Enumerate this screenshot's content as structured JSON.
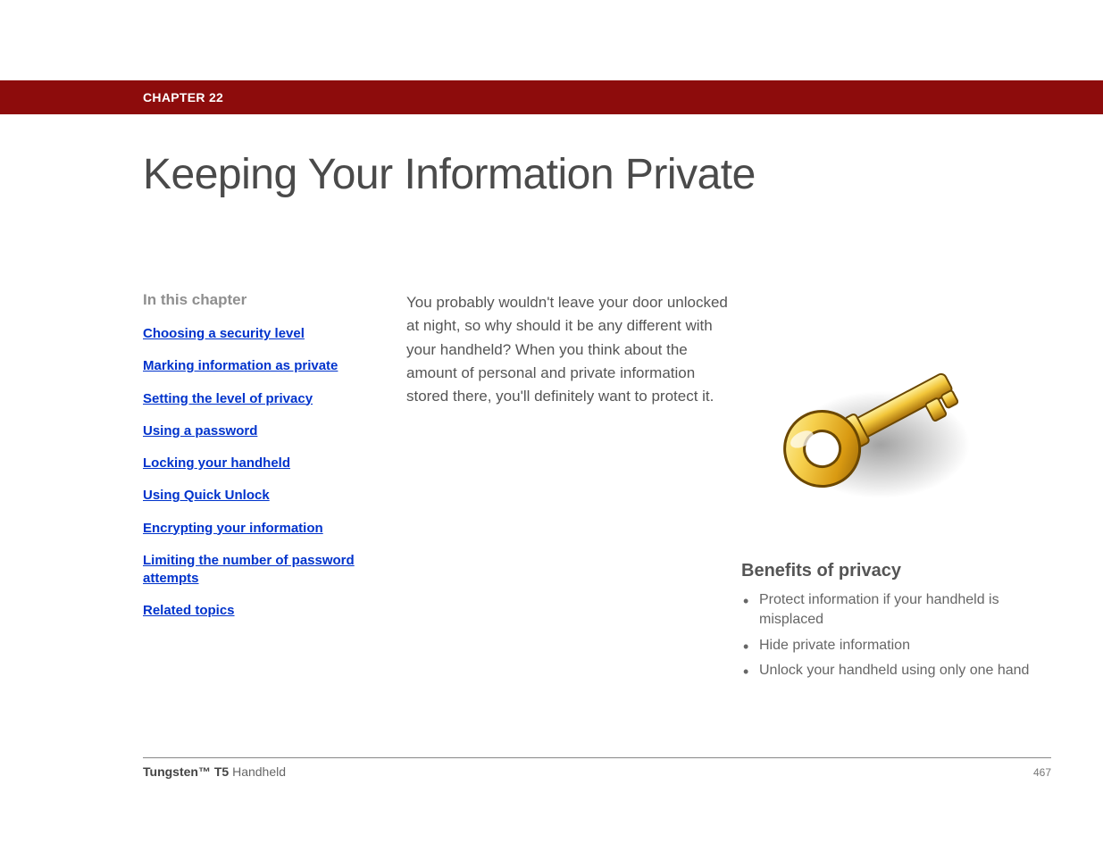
{
  "header": {
    "chapter_label": "CHAPTER 22"
  },
  "title": "Keeping Your Information Private",
  "sidebar": {
    "heading": "In this chapter",
    "items": [
      "Choosing a security level",
      "Marking information as private",
      "Setting the level of privacy",
      "Using a password",
      "Locking your handheld",
      "Using Quick Unlock",
      "Encrypting your information",
      "Limiting the number of password attempts",
      "Related topics"
    ]
  },
  "intro_text": "You probably wouldn't leave your door unlocked at night, so why should it be any different with your handheld? When you think about the amount of personal and private information stored there, you'll definitely want to protect it.",
  "benefits": {
    "heading": "Benefits of privacy",
    "items": [
      "Protect information if your handheld is misplaced",
      "Hide private information",
      "Unlock your handheld using only one hand"
    ]
  },
  "footer": {
    "product_bold": "Tungsten™ T5",
    "product_rest": " Handheld",
    "page_number": "467"
  },
  "icons": {
    "key": "key-icon"
  }
}
